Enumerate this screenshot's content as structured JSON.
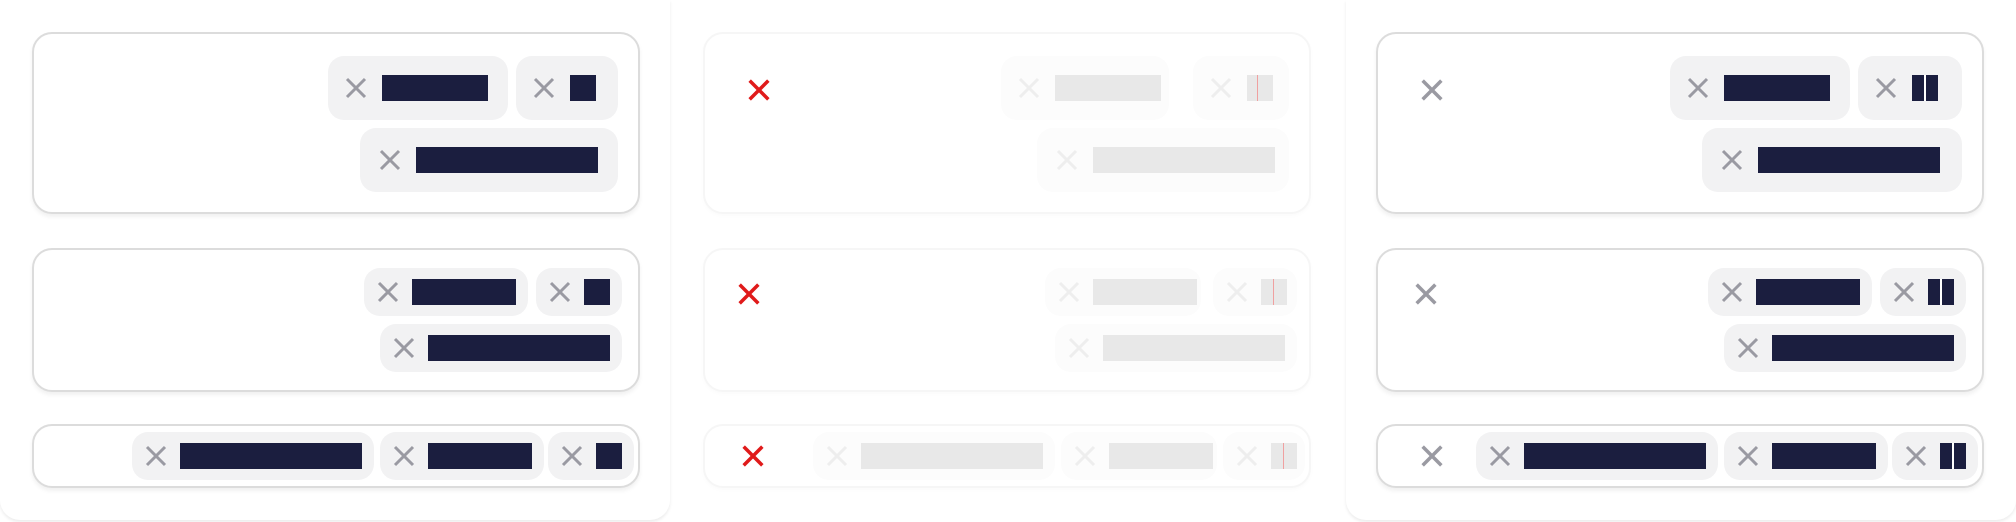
{
  "colors": {
    "chip_text_bar": "#1b1e3f",
    "chip_bg": "#f2f2f3",
    "remove_icon": "#9a9aa2",
    "clear_icon_error": "#e01a1a",
    "faded_bar": "#e8e8e8",
    "card_border": "#dcdcdc"
  },
  "icons": {
    "remove": "close-icon",
    "clear_all": "close-icon"
  },
  "panels": [
    {
      "state": "default",
      "clear_all_icon": "none"
    },
    {
      "state": "disabled-error",
      "clear_all_icon": "close-icon-red"
    },
    {
      "state": "clearable",
      "clear_all_icon": "close-icon-gray"
    }
  ]
}
